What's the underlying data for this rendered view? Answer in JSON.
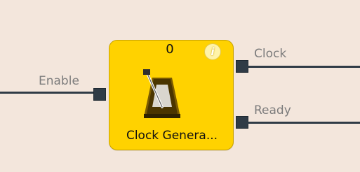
{
  "diagram": {
    "block": {
      "title": "Clock Genera...",
      "counter": "0",
      "info_icon_glyph": "i",
      "icon_name": "metronome-icon",
      "fill_color": "#ffd200"
    },
    "inputs": [
      {
        "label": "Enable"
      }
    ],
    "outputs": [
      {
        "label": "Clock"
      },
      {
        "label": "Ready"
      }
    ],
    "wire_color": "#2f3b46",
    "background_color": "#f3e6dc"
  }
}
